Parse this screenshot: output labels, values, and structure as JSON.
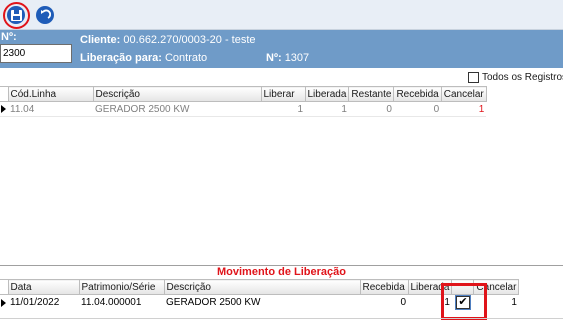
{
  "toolbar": {
    "save_icon": "floppy-save-icon",
    "back_icon": "back-arrow-icon",
    "accent": "#1f5cb8"
  },
  "header": {
    "no_label": "Nº:",
    "no_value": "2300",
    "cliente_label": "Cliente:",
    "cliente_value": "00.662.270/0003-20 - teste",
    "liberacao_label": "Liberação para:",
    "liberacao_value": "Contrato",
    "numero_label": "Nº:",
    "numero_value": "1307",
    "band_color": "#6f9bc8"
  },
  "todos_registros": {
    "label": "Todos os Registros",
    "checked": false
  },
  "grid_itens": {
    "columns": [
      "Cód.Linha",
      "Descrição",
      "Liberar",
      "Liberada",
      "Restante",
      "Recebida",
      "Cancelar"
    ],
    "rows": [
      {
        "cod_linha": "11.04",
        "descricao": "GERADOR 2500 KW",
        "liberar": "1",
        "liberada": "1",
        "restante": "0",
        "recebida": "0",
        "cancelar": "1"
      }
    ]
  },
  "movimento": {
    "title": "Movimento de Liberação",
    "columns": [
      "Data",
      "Patrimonio/Série",
      "Descrição",
      "Recebida",
      "Liberada",
      "",
      "Cancelar"
    ],
    "rows": [
      {
        "data": "11/01/2022",
        "patrimonio": "11.04.000001",
        "descricao": "GERADOR 2500 KW",
        "recebida": "0",
        "liberada": "1",
        "check": "✔",
        "cancelar": "1"
      }
    ]
  }
}
